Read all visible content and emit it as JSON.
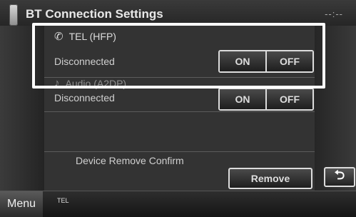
{
  "header": {
    "title": "BT Connection Settings",
    "clock": "--:--"
  },
  "tel": {
    "label": "TEL (HFP)",
    "status": "Disconnected",
    "on_label": "ON",
    "off_label": "OFF"
  },
  "audio": {
    "label": "Audio (A2DP)",
    "status": "Disconnected",
    "on_label": "ON",
    "off_label": "OFF"
  },
  "remove": {
    "label": "Device Remove Confirm",
    "button": "Remove"
  },
  "footer": {
    "menu": "Menu",
    "source": "TEL"
  },
  "icons": {
    "tel": "phone-handset-icon",
    "audio": "music-note-icon",
    "back": "return-arrow-icon"
  }
}
